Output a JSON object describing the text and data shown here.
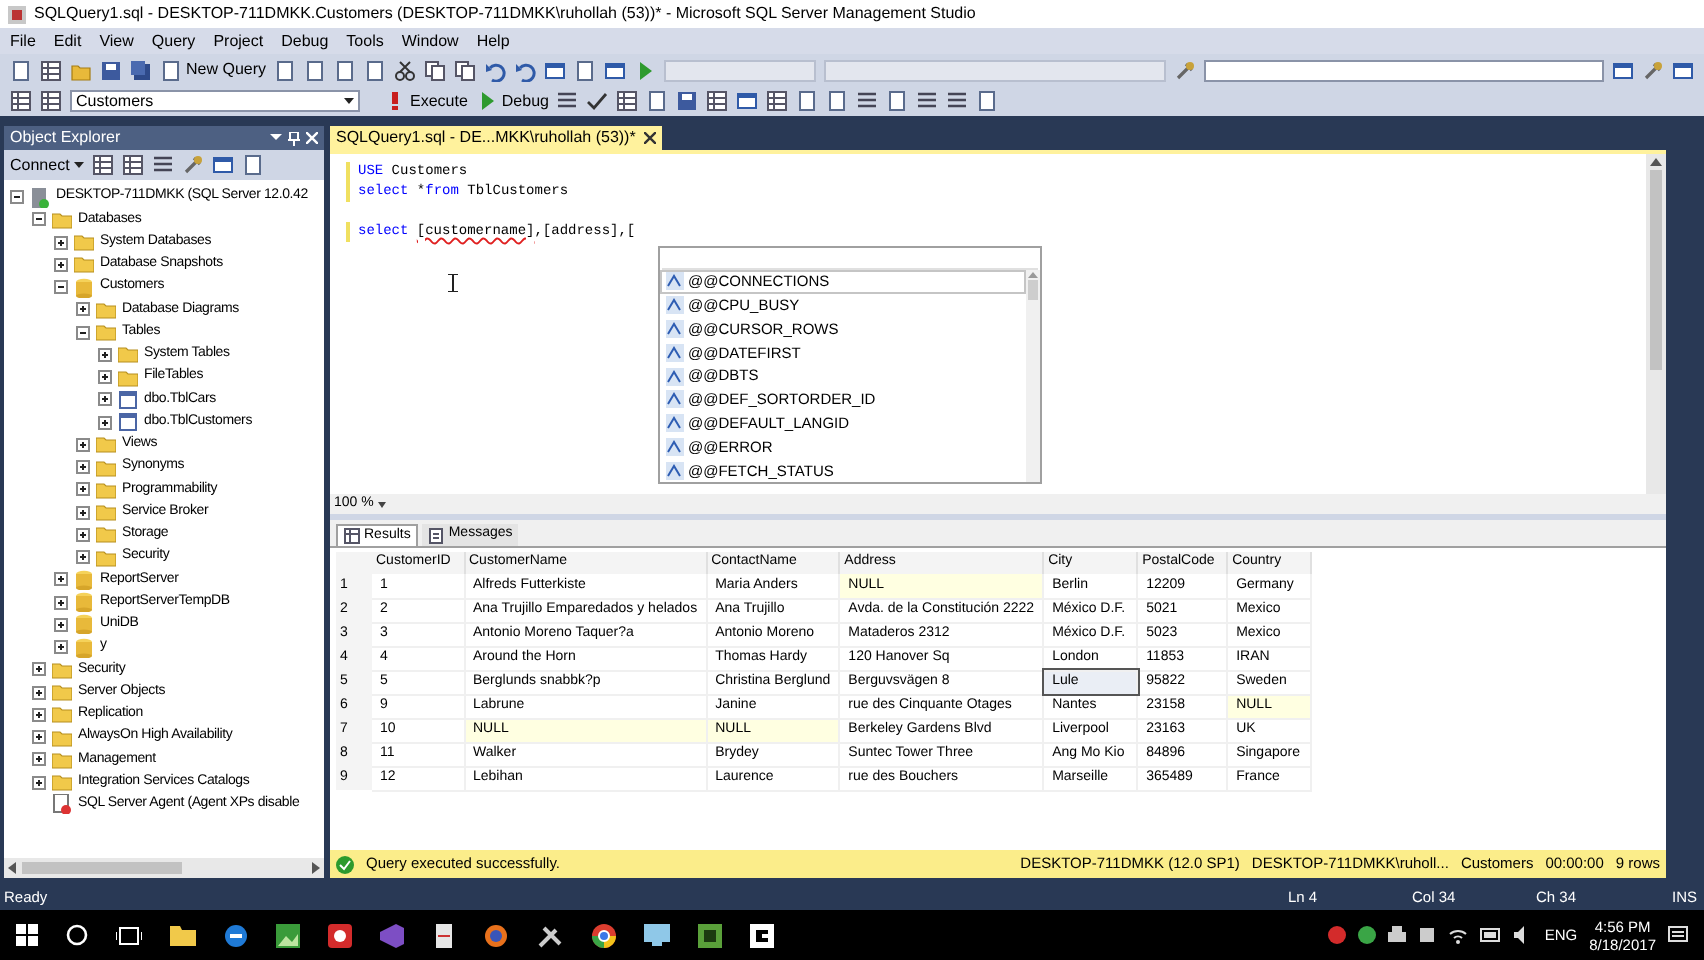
{
  "window": {
    "title": "SQLQuery1.sql - DESKTOP-711DMKK.Customers (DESKTOP-711DMKK\\ruhollah (53))* - Microsoft SQL Server Management Studio"
  },
  "menu": [
    "File",
    "Edit",
    "View",
    "Query",
    "Project",
    "Debug",
    "Tools",
    "Window",
    "Help"
  ],
  "toolbar": {
    "new_query": "New Query",
    "database": "Customers",
    "execute": "Execute",
    "debug": "Debug"
  },
  "object_explorer": {
    "title": "Object Explorer",
    "connect": "Connect",
    "tree": [
      {
        "label": "DESKTOP-711DMKK (SQL Server 12.0.42",
        "kind": "server",
        "expanded": true,
        "children": [
          {
            "label": "Databases",
            "kind": "folder",
            "expanded": true,
            "children": [
              {
                "label": "System Databases",
                "kind": "folder",
                "expanded": false
              },
              {
                "label": "Database Snapshots",
                "kind": "folder",
                "expanded": false
              },
              {
                "label": "Customers",
                "kind": "database",
                "expanded": true,
                "children": [
                  {
                    "label": "Database Diagrams",
                    "kind": "folder",
                    "expanded": false
                  },
                  {
                    "label": "Tables",
                    "kind": "folder",
                    "expanded": true,
                    "children": [
                      {
                        "label": "System Tables",
                        "kind": "folder",
                        "expanded": false
                      },
                      {
                        "label": "FileTables",
                        "kind": "folder",
                        "expanded": false
                      },
                      {
                        "label": "dbo.TblCars",
                        "kind": "table",
                        "expanded": false
                      },
                      {
                        "label": "dbo.TblCustomers",
                        "kind": "table",
                        "expanded": false
                      }
                    ]
                  },
                  {
                    "label": "Views",
                    "kind": "folder",
                    "expanded": false
                  },
                  {
                    "label": "Synonyms",
                    "kind": "folder",
                    "expanded": false
                  },
                  {
                    "label": "Programmability",
                    "kind": "folder",
                    "expanded": false
                  },
                  {
                    "label": "Service Broker",
                    "kind": "folder",
                    "expanded": false
                  },
                  {
                    "label": "Storage",
                    "kind": "folder",
                    "expanded": false
                  },
                  {
                    "label": "Security",
                    "kind": "folder",
                    "expanded": false
                  }
                ]
              },
              {
                "label": "ReportServer",
                "kind": "database",
                "expanded": false
              },
              {
                "label": "ReportServerTempDB",
                "kind": "database",
                "expanded": false
              },
              {
                "label": "UniDB",
                "kind": "database",
                "expanded": false
              },
              {
                "label": "y",
                "kind": "database",
                "expanded": false
              }
            ]
          },
          {
            "label": "Security",
            "kind": "folder",
            "expanded": false
          },
          {
            "label": "Server Objects",
            "kind": "folder",
            "expanded": false
          },
          {
            "label": "Replication",
            "kind": "folder",
            "expanded": false
          },
          {
            "label": "AlwaysOn High Availability",
            "kind": "folder",
            "expanded": false
          },
          {
            "label": "Management",
            "kind": "folder",
            "expanded": false
          },
          {
            "label": "Integration Services Catalogs",
            "kind": "folder",
            "expanded": false
          },
          {
            "label": "SQL Server Agent (Agent XPs disable",
            "kind": "agent"
          }
        ]
      }
    ]
  },
  "editor": {
    "tab": "SQLQuery1.sql - DE...MKK\\ruhollah (53))*",
    "lines": [
      {
        "kind": "code",
        "segments": [
          {
            "kind": "keyword",
            "text": "USE"
          },
          {
            "kind": "plain",
            "text": " Customers"
          }
        ]
      },
      {
        "kind": "code",
        "segments": [
          {
            "kind": "keyword",
            "text": "select"
          },
          {
            "kind": "plain",
            "text": " *"
          },
          {
            "kind": "keyword",
            "text": "from"
          },
          {
            "kind": "plain",
            "text": " TblCustomers"
          }
        ]
      },
      {
        "kind": "blank"
      },
      {
        "kind": "code",
        "segments": [
          {
            "kind": "keyword",
            "text": "select "
          },
          {
            "kind": "error",
            "text": "[customername]"
          },
          {
            "kind": "plain",
            "text": ",[address],["
          }
        ]
      }
    ],
    "autocomplete": [
      {
        "label": "@@CONNECTIONS",
        "selected": true
      },
      {
        "label": "@@CPU_BUSY",
        "selected": false
      },
      {
        "label": "@@CURSOR_ROWS",
        "selected": false
      },
      {
        "label": "@@DATEFIRST",
        "selected": false
      },
      {
        "label": "@@DBTS",
        "selected": false
      },
      {
        "label": "@@DEF_SORTORDER_ID",
        "selected": false
      },
      {
        "label": "@@DEFAULT_LANGID",
        "selected": false
      },
      {
        "label": "@@ERROR",
        "selected": false
      },
      {
        "label": "@@FETCH_STATUS",
        "selected": false
      }
    ],
    "zoom": "100 %"
  },
  "results": {
    "tabs": [
      {
        "label": "Results",
        "selected": true
      },
      {
        "label": "Messages",
        "selected": false
      }
    ],
    "columns": [
      "CustomerID",
      "CustomerName",
      "ContactName",
      "Address",
      "City",
      "PostalCode",
      "Country"
    ],
    "rows": [
      {
        "number": "1",
        "cells": [
          {
            "text": "1",
            "tinted": false,
            "selected": false
          },
          {
            "text": "Alfreds Futterkiste",
            "tinted": false,
            "selected": false
          },
          {
            "text": "Maria Anders",
            "tinted": false,
            "selected": false
          },
          {
            "text": "NULL",
            "tinted": true,
            "selected": false
          },
          {
            "text": "Berlin",
            "tinted": false,
            "selected": false
          },
          {
            "text": "12209",
            "tinted": false,
            "selected": false
          },
          {
            "text": "Germany",
            "tinted": false,
            "selected": false
          }
        ]
      },
      {
        "number": "2",
        "cells": [
          {
            "text": "2",
            "tinted": false,
            "selected": false
          },
          {
            "text": "Ana Trujillo Emparedados y helados",
            "tinted": false,
            "selected": false
          },
          {
            "text": "Ana Trujillo",
            "tinted": false,
            "selected": false
          },
          {
            "text": "Avda. de la Constitución 2222",
            "tinted": false,
            "selected": false
          },
          {
            "text": "México D.F.",
            "tinted": false,
            "selected": false
          },
          {
            "text": "5021",
            "tinted": false,
            "selected": false
          },
          {
            "text": "Mexico",
            "tinted": false,
            "selected": false
          }
        ]
      },
      {
        "number": "3",
        "cells": [
          {
            "text": "3",
            "tinted": false,
            "selected": false
          },
          {
            "text": "Antonio Moreno Taquer?a",
            "tinted": false,
            "selected": false
          },
          {
            "text": "Antonio Moreno",
            "tinted": false,
            "selected": false
          },
          {
            "text": "Mataderos 2312",
            "tinted": false,
            "selected": false
          },
          {
            "text": "México D.F.",
            "tinted": false,
            "selected": false
          },
          {
            "text": "5023",
            "tinted": false,
            "selected": false
          },
          {
            "text": "Mexico",
            "tinted": false,
            "selected": false
          }
        ]
      },
      {
        "number": "4",
        "cells": [
          {
            "text": "4",
            "tinted": false,
            "selected": false
          },
          {
            "text": "Around the Horn",
            "tinted": false,
            "selected": false
          },
          {
            "text": "Thomas Hardy",
            "tinted": false,
            "selected": false
          },
          {
            "text": "120 Hanover Sq",
            "tinted": false,
            "selected": false
          },
          {
            "text": "London",
            "tinted": false,
            "selected": false
          },
          {
            "text": "11853",
            "tinted": false,
            "selected": false
          },
          {
            "text": "IRAN",
            "tinted": false,
            "selected": false
          }
        ]
      },
      {
        "number": "5",
        "cells": [
          {
            "text": "5",
            "tinted": false,
            "selected": false
          },
          {
            "text": "Berglunds snabbk?p",
            "tinted": false,
            "selected": false
          },
          {
            "text": "Christina Berglund",
            "tinted": false,
            "selected": false
          },
          {
            "text": "Berguvsvägen 8",
            "tinted": false,
            "selected": false
          },
          {
            "text": "Lule",
            "tinted": false,
            "selected": true
          },
          {
            "text": "95822",
            "tinted": false,
            "selected": false
          },
          {
            "text": "Sweden",
            "tinted": false,
            "selected": false
          }
        ]
      },
      {
        "number": "6",
        "cells": [
          {
            "text": "9",
            "tinted": false,
            "selected": false
          },
          {
            "text": "Labrune",
            "tinted": false,
            "selected": false
          },
          {
            "text": "Janine",
            "tinted": false,
            "selected": false
          },
          {
            "text": "rue des Cinquante Otages",
            "tinted": false,
            "selected": false
          },
          {
            "text": "Nantes",
            "tinted": false,
            "selected": false
          },
          {
            "text": "23158",
            "tinted": false,
            "selected": false
          },
          {
            "text": "NULL",
            "tinted": true,
            "selected": false
          }
        ]
      },
      {
        "number": "7",
        "cells": [
          {
            "text": "10",
            "tinted": false,
            "selected": false
          },
          {
            "text": "NULL",
            "tinted": true,
            "selected": false
          },
          {
            "text": "NULL",
            "tinted": true,
            "selected": false
          },
          {
            "text": "Berkeley Gardens Blvd",
            "tinted": false,
            "selected": false
          },
          {
            "text": "Liverpool",
            "tinted": false,
            "selected": false
          },
          {
            "text": "23163",
            "tinted": false,
            "selected": false
          },
          {
            "text": "UK",
            "tinted": false,
            "selected": false
          }
        ]
      },
      {
        "number": "8",
        "cells": [
          {
            "text": "11",
            "tinted": false,
            "selected": false
          },
          {
            "text": "Walker",
            "tinted": false,
            "selected": false
          },
          {
            "text": "Brydey",
            "tinted": false,
            "selected": false
          },
          {
            "text": "Suntec Tower Three",
            "tinted": false,
            "selected": false
          },
          {
            "text": "Ang Mo Kio",
            "tinted": false,
            "selected": false
          },
          {
            "text": "84896",
            "tinted": false,
            "selected": false
          },
          {
            "text": "Singapore",
            "tinted": false,
            "selected": false
          }
        ]
      },
      {
        "number": "9",
        "cells": [
          {
            "text": "12",
            "tinted": false,
            "selected": false
          },
          {
            "text": "Lebihan",
            "tinted": false,
            "selected": false
          },
          {
            "text": "Laurence",
            "tinted": false,
            "selected": false
          },
          {
            "text": "rue des Bouchers",
            "tinted": false,
            "selected": false
          },
          {
            "text": "Marseille",
            "tinted": false,
            "selected": false
          },
          {
            "text": "365489",
            "tinted": false,
            "selected": false
          },
          {
            "text": "France",
            "tinted": false,
            "selected": false
          }
        ]
      }
    ],
    "status": {
      "message": "Query executed successfully.",
      "server": "DESKTOP-711DMKK (12.0 SP1)",
      "user": "DESKTOP-711DMKK\\ruholl...",
      "database": "Customers",
      "time": "00:00:00",
      "rows": "9 rows"
    }
  },
  "status_bar": {
    "text": "Ready",
    "line": "Ln 4",
    "column": "Col 34",
    "char": "Ch 34",
    "mode": "INS"
  },
  "taskbar": {
    "language": "ENG",
    "time": "4:56 PM",
    "date": "8/18/2017"
  }
}
